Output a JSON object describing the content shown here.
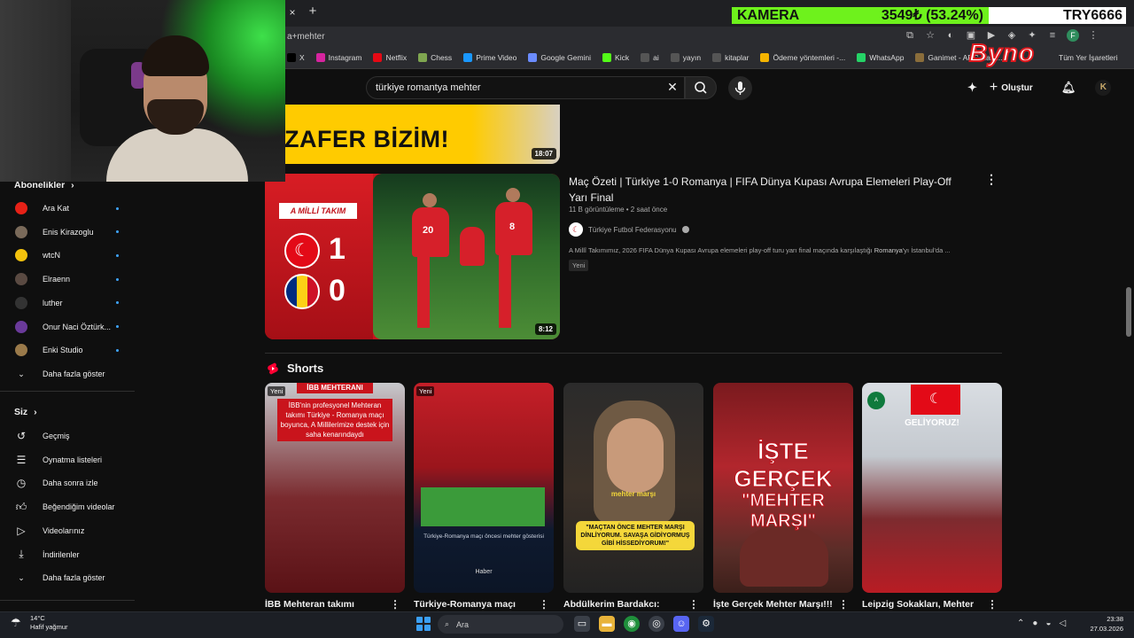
{
  "browser": {
    "tab_close": "×",
    "tab_new": "+",
    "url_fragment": "a+mehter",
    "bookmarks": [
      {
        "label": "X",
        "color": "#000000",
        "icon": "x-logo-icon"
      },
      {
        "label": "Instagram",
        "color": "#d6249f",
        "icon": "instagram-icon"
      },
      {
        "label": "Netflix",
        "color": "#e50914",
        "icon": "netflix-icon"
      },
      {
        "label": "Chess",
        "color": "#7fa650",
        "icon": "chess-icon"
      },
      {
        "label": "Prime Video",
        "color": "#1a98ff",
        "icon": "prime-video-icon"
      },
      {
        "label": "Google Gemini",
        "color": "#6b8cff",
        "icon": "gemini-icon"
      },
      {
        "label": "Kick",
        "color": "#53fc18",
        "icon": "kick-icon"
      },
      {
        "label": "ai",
        "color": "#555555",
        "icon": "folder-icon"
      },
      {
        "label": "yayın",
        "color": "#555555",
        "icon": "folder-icon"
      },
      {
        "label": "kitaplar",
        "color": "#555555",
        "icon": "folder-icon"
      },
      {
        "label": "Ödeme yöntemleri -...",
        "color": "#f4b400",
        "icon": "payment-icon"
      },
      {
        "label": "WhatsApp",
        "color": "#25d366",
        "icon": "whatsapp-icon"
      },
      {
        "label": "Ganimet - ARC Raid...",
        "color": "#8a6d3b",
        "icon": "ganimet-icon"
      }
    ],
    "all_bookmarks": "Tüm Yer İşaretleri",
    "profile_initial": "F"
  },
  "overlay": {
    "ticker_name": "KAMERA",
    "ticker_value": "3549₺ (53.24%)",
    "ticker_code": "TRY6666",
    "logo_text": "Byno",
    "accent": "#6ef21c"
  },
  "header": {
    "search_query": "türkiye romantya mehter",
    "create_label": "Oluştur",
    "avatar_initial": "K"
  },
  "sidebar": {
    "subscriptions_title": "Abonelikler",
    "subscriptions": [
      {
        "label": "Ara Kat",
        "color": "#e62117"
      },
      {
        "label": "Enis Kirazoglu",
        "color": "#7a6a5a"
      },
      {
        "label": "wtcN",
        "color": "#f4c20d"
      },
      {
        "label": "Elraenn",
        "color": "#5a4a42"
      },
      {
        "label": "luther",
        "color": "#333333"
      },
      {
        "label": "Onur Naci Öztürk...",
        "color": "#6a3a9a"
      },
      {
        "label": "Enki Studio",
        "color": "#9a7a4a"
      }
    ],
    "show_more_1": "Daha fazla göster",
    "you_title": "Siz",
    "you_items": [
      {
        "label": "Geçmiş",
        "icon": "history-icon"
      },
      {
        "label": "Oynatma listeleri",
        "icon": "playlists-icon"
      },
      {
        "label": "Daha sonra izle",
        "icon": "watch-later-icon"
      },
      {
        "label": "Beğendiğim videolar",
        "icon": "liked-videos-icon"
      },
      {
        "label": "Videolarınız",
        "icon": "your-videos-icon"
      },
      {
        "label": "İndirilenler",
        "icon": "downloads-icon"
      }
    ],
    "show_more_2": "Daha fazla göster"
  },
  "results": {
    "video1": {
      "thumb_text": "ZAFER BİZİM!",
      "duration": "18:07"
    },
    "video2": {
      "title": "Maç Özeti | Türkiye 1-0 Romanya | FIFA Dünya Kupası Avrupa Elemeleri Play-Off Yarı Final",
      "meta": "11 B görüntüleme • 2 saat önce",
      "channel": "Türkiye Futbol Federasyonu",
      "description_pre": "A Millî Takımımız, 2026 FIFA Dünya Kupası Avrupa elemeleri play-off turu yarı final maçında karşılaştığı ",
      "description_bold": "Romanya",
      "description_post": "'yı İstanbul'da ...",
      "badge": "Yeni",
      "duration": "8:12",
      "thumb_badge": "A MİLLİ TAKIM",
      "score_home": "1",
      "score_away": "0",
      "jersey_left": "20",
      "jersey_right": "8"
    },
    "shorts_title": "Shorts",
    "shorts": [
      {
        "title": "İBB Mehteran takımı",
        "new": "Yeni",
        "banner": "İBB MEHTERANI",
        "caption": "İBB'nin profesyonel Mehteran takımı Türkiye - Romanya maçı boyunca, A Millilerimize destek için saha kenarındaydı"
      },
      {
        "title": "Türkiye-Romanya maçı",
        "new": "Yeni",
        "caption": "Türkiye-Romanya maçı öncesi mehter gösterisi",
        "logo": "Haber"
      },
      {
        "title": "Abdülkerim Bardakcı:",
        "label": "mehter marşı",
        "quote": "\"MAÇTAN ÖNCE MEHTER MARŞI DİNLİYORUM. SAVAŞA GİDİYORMUŞ GİBİ HİSSEDİYORUM!\""
      },
      {
        "title": "İşte Gerçek Mehter Marşı!!!",
        "line1": "İŞTE GERÇEK",
        "line2": "\"MEHTER MARŞI\""
      },
      {
        "title": "Leipzig Sokakları, Mehter",
        "overlay": "GELİYORUZ!"
      }
    ]
  },
  "taskbar": {
    "temperature": "14°C",
    "weather": "Hafif yağmur",
    "search_placeholder": "Ara",
    "time": "23:38",
    "date": "27.03.2026"
  }
}
